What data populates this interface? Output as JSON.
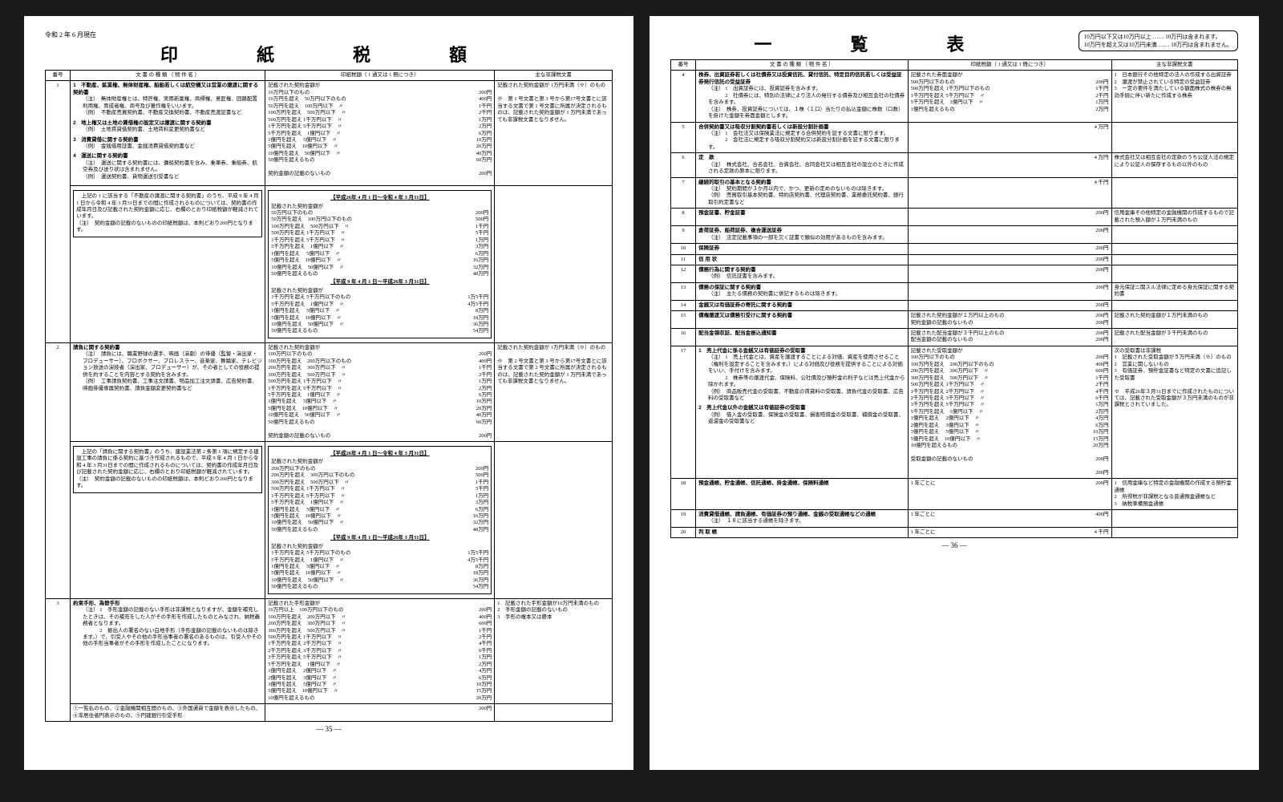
{
  "meta": {
    "date": "令和 2 年 6 月現在",
    "page_left": "— 35 —",
    "page_right": "— 36 —",
    "title_left": "印　紙　税　額",
    "title_right": "一　覧　表",
    "top_note": [
      "10万円以下又は10万円以上 …… 10万円は含まれます。",
      "10万円を超え又は10万円未満 …… 10万円は含まれません。"
    ]
  },
  "headers": {
    "num": "番号",
    "doc": "文 書 の 種 類 （ 物 件 名 ）",
    "tax": "印紙税額（ 1 通又は 1 冊につき）",
    "exempt": "主な非課税文書"
  },
  "rowL1": {
    "num": "1",
    "docs": [
      {
        "h": "1　不動産、鉱業権、無体財産権、船舶若しくは航空機又は営業の譲渡に関する契約書",
        "notes": [
          "（注）　無体財産権とは、特許権、実用新案権、商標権、意匠権、回路配置利用権、育成者権、商号及び著作権をいいます。",
          "（例）　不動産売買契約書、不動産交換契約書、不動産売渡証書など"
        ]
      },
      {
        "h": "2　地上権又は土地の賃借権の設定又は譲渡に関する契約書",
        "notes": [
          "（例）　土地賃貸借契約書、土地賃料変更契約書など"
        ]
      },
      {
        "h": "3　消費貸借に関する契約書",
        "notes": [
          "（例）　金銭借用証書、金銭消費貸借契約書など"
        ]
      },
      {
        "h": "4　運送に関する契約書",
        "notes": [
          "（注）　運送に関する契約書には、傭船契約書を含み、乗車券、乗船券、航空券及び送り状は含まれません。",
          "（例）　運送契約書、貨物運送引受書など"
        ]
      }
    ],
    "tax_head": "記載された契約金額が",
    "tax": [
      [
        "10万円以下のもの",
        "200円"
      ],
      [
        "10万円を超え　50万円以下のもの",
        "400円"
      ],
      [
        "50万円を超え　100万円以下　〃",
        "1千円"
      ],
      [
        "100万円を超え　500万円以下　〃",
        "2千円"
      ],
      [
        "500万円を超え 1千万円以下　〃",
        "1万円"
      ],
      [
        "1千万円を超え 5千万円以下　〃",
        "2万円"
      ],
      [
        "5千万円を超え　1億円以下　〃",
        "6万円"
      ],
      [
        "1億円を超え　 5億円以下　〃",
        "10万円"
      ],
      [
        "5億円を超え　10億円以下　〃",
        "20万円"
      ],
      [
        "10億円を超え　50億円以下　〃",
        "40万円"
      ],
      [
        "50億円を超えるもの",
        "60万円"
      ],
      [
        "",
        ""
      ],
      [
        "契約金額の記載のないもの",
        "200円"
      ]
    ],
    "exempt": [
      "記載された契約金額が 1万円未満（※）のもの",
      "",
      "※　第 1 号文書と第 3 号から第17号文書とに該当する文書で第 1 号文書に所属が決定されるものは、記載された契約金額が 1 万円未満であっても非課税文書となりません。"
    ]
  },
  "rowL1b": {
    "intro": "　上記の 1 に該当する「不動産の譲渡に関する契約書」のうち、平成 9 年 4 月 1 日から令和 4 年 3 月31日までの間に作成されるものについては、契約書の作成年月日及び記載された契約金額に応じ、右欄のとおり印紙税額が軽減されています。",
    "note": "（注）　契約金額の記載のないものの印紙税額は、本則どおり200円となります。",
    "periodA": "【平成26年 4 月 1 日〜令和 4 年 3 月31日】",
    "taxA": [
      [
        "50万円以下のもの",
        "200円"
      ],
      [
        "50万円を超え　100万円以下のもの",
        "500円"
      ],
      [
        "100万円を超え　500万円以下　〃",
        "1千円"
      ],
      [
        "500万円を超え 1千万円以下　〃",
        "5千円"
      ],
      [
        "1千万円を超え 5千万円以下　〃",
        "1万円"
      ],
      [
        "5千万円を超え　1億円以下　〃",
        "3万円"
      ],
      [
        "1億円を超え　 5億円以下　〃",
        "6万円"
      ],
      [
        "5億円を超え　10億円以下　〃",
        "16万円"
      ],
      [
        "10億円を超え　50億円以下　〃",
        "32万円"
      ],
      [
        "50億円を超えるもの",
        "48万円"
      ]
    ],
    "periodB": "【平成 9 年 4 月 1 日〜平成26年 3 月31日】",
    "taxB": [
      [
        "1千万円を超え 5千万円以下のもの",
        "1万5千円"
      ],
      [
        "5千万円を超え　1億円以下　〃",
        "4万5千円"
      ],
      [
        "1億円を超え　 5億円以下　〃",
        "8万円"
      ],
      [
        "5億円を超え　10億円以下　〃",
        "18万円"
      ],
      [
        "10億円を超え　50億円以下　〃",
        "36万円"
      ],
      [
        "50億円を超えるもの",
        "54万円"
      ]
    ]
  },
  "rowL2": {
    "num": "2",
    "doc": {
      "h": "請負に関する契約書",
      "notes": [
        "（注）　請負には、職業野球の選手、映画（演劇）の俳優（監督・演出家・プロデューサー）、プロボクサー、プロレスラー、音楽家、舞踊家、テレビジョン放送の演技者（演出家、プロデューサー）が、その者としての役務の提供を約することを内容とする契約を含みます。",
        "（例）　工事請負契約書、工事注文請書、物品加工注文請書、広告契約書、映画俳優専属契約書、請負金額変更契約書など"
      ]
    },
    "tax_head": "記載された契約金額が",
    "tax": [
      [
        "100万円以下のもの",
        "200円"
      ],
      [
        "100万円を超え　200万円以下のもの",
        "400円"
      ],
      [
        "200万円を超え　300万円以下　〃",
        "1千円"
      ],
      [
        "300万円を超え　500万円以下　〃",
        "2千円"
      ],
      [
        "500万円を超え 1千万円以下　〃",
        "1万円"
      ],
      [
        "1千万円を超え 5千万円以下　〃",
        "2万円"
      ],
      [
        "5千万円を超え　1億円以下　〃",
        "6万円"
      ],
      [
        "1億円を超え　 5億円以下　〃",
        "10万円"
      ],
      [
        "5億円を超え　10億円以下　〃",
        "20万円"
      ],
      [
        "10億円を超え　50億円以下　〃",
        "40万円"
      ],
      [
        "50億円を超えるもの",
        "60万円"
      ],
      [
        "",
        ""
      ],
      [
        "契約金額の記載のないもの",
        "200円"
      ]
    ],
    "exempt": [
      "記載された契約金額が 1万円未満（※）のもの",
      "",
      "※　第 2 号文書と第 3 号から第17号文書とに該当する文書で第 2 号文書に所属が決定されるものは、記載された契約金額が 1 万円未満であっても非課税文書となりません。"
    ]
  },
  "rowL2b": {
    "intro": "　上記の「請負に関する契約書」のうち、建設業法第 2 条第 1 項に規定する建設工事の請負に係る契約に基づき作成されるもので、平成 9 年 4 月 1 日から令和 4 年 3 月31日までの間に作成されるものについては、契約書の作成年月日及び記載された契約金額に応じ、右欄のとおり印紙税額が軽減されています。",
    "note": "（注）　契約金額の記載のないものの印紙税額は、本則どおり200円となります。",
    "periodA": "【平成26年 4 月 1 日〜令和 4 年 3 月31日】",
    "taxA": [
      [
        "200万円以下のもの",
        "200円"
      ],
      [
        "200万円を超え　300万円以下のもの",
        "500円"
      ],
      [
        "300万円を超え　500万円以下　〃",
        "1千円"
      ],
      [
        "500万円を超え 1千万円以下　〃",
        "5千円"
      ],
      [
        "1千万円を超え 5千万円以下　〃",
        "1万円"
      ],
      [
        "5千万円を超え　1億円以下　〃",
        "3万円"
      ],
      [
        "1億円を超え　 5億円以下　〃",
        "6万円"
      ],
      [
        "5億円を超え　10億円以下　〃",
        "16万円"
      ],
      [
        "10億円を超え　50億円以下　〃",
        "32万円"
      ],
      [
        "50億円を超えるもの",
        "48万円"
      ]
    ],
    "periodB": "【平成 9 年 4 月 1 日〜平成26年 3 月31日】",
    "taxB": [
      [
        "1千万円を超え 5千万円以下のもの",
        "1万5千円"
      ],
      [
        "5千万円を超え　1億円以下　〃",
        "4万5千円"
      ],
      [
        "1億円を超え　 5億円以下　〃",
        "8万円"
      ],
      [
        "5億円を超え　10億円以下　〃",
        "18万円"
      ],
      [
        "10億円を超え　50億円以下　〃",
        "36万円"
      ],
      [
        "50億円を超えるもの",
        "54万円"
      ]
    ]
  },
  "rowL3": {
    "num": "3",
    "doc": {
      "h": "約束手形、為替手形",
      "notes": [
        "（注） 1　手形金額の記載のない手形は非課税となりますが、金額を補充したときは、その補充をした人がその手形を作成したものとみなされ、納税義務者となります。",
        "　　　 2　振出人の署名のない白地手形（手形金額の記載のないものは除きます。）で、引受人やその他の手形当事者の署名のあるものは、引受人やその他の手形当事者がその手形を作成したことになります。"
      ]
    },
    "tax_head": "記載された手形金額が",
    "tax": [
      [
        "10万円以上　100万円以下のもの",
        "200円"
      ],
      [
        "100万円を超え　200万円以下　〃",
        "400円"
      ],
      [
        "200万円を超え　300万円以下　〃",
        "600円"
      ],
      [
        "300万円を超え　500万円以下　〃",
        "1千円"
      ],
      [
        "500万円を超え 1千万円以下　〃",
        "2千円"
      ],
      [
        "1千万円を超え 2千万円以下　〃",
        "4千円"
      ],
      [
        "2千万円を超え 3千万円以下　〃",
        "6千円"
      ],
      [
        "3千万円を超え 5千万円以下　〃",
        "1万円"
      ],
      [
        "5千万円を超え　1億円以下　〃",
        "2万円"
      ],
      [
        "1億円を超え　 2億円以下　〃",
        "4万円"
      ],
      [
        "2億円を超え　 3億円以下　〃",
        "6万円"
      ],
      [
        "3億円を超え　 5億円以下　〃",
        "10万円"
      ],
      [
        "5億円を超え　10億円以下　〃",
        "15万円"
      ],
      [
        "10億円を超えるもの",
        "20万円"
      ]
    ],
    "exempt": [
      "1　記載された手形金額が10万円未満のもの",
      "2　手形金額の記載のないもの",
      "3　手形の複本又は謄本"
    ],
    "foot": "①一覧払のもの、②金融機関相互間のもの、③外国通貨で金額を表示したもの、④非居住者円表示のもの、⑤円建銀行引受手形",
    "foot_amt": "200円"
  },
  "rowsR": [
    {
      "n": "4",
      "doc": "株券、出資証券若しくは社債券又は投資信託、貸付信託、特定目的信託若しくは受益証券発行信託の受益証券",
      "notes": [
        "（注） 1　出資証券には、投資証券を含みます。",
        "　　　 2　社債券には、特別の法律により法人の発行する債券及び相互会社の社債券を含みます。",
        "",
        "（注）　株券、投資証券については、１株（１口）当たりの払込金額に株数（口数）を掛けた金額を券面金額とします。"
      ],
      "tax_head": "記載された券面金額が",
      "tax": [
        [
          "500万円以下のもの",
          "200円"
        ],
        [
          "500万円を超え 1千万円以下のもの",
          "1千円"
        ],
        [
          "1千万円を超え 5千万円以下　〃",
          "2千円"
        ],
        [
          "5千万円を超え　1億円以下　〃",
          "1万円"
        ],
        [
          "1億円を超えるもの",
          "2万円"
        ]
      ],
      "exempt": [
        "1　日本銀行その他特定の法人の作成する出資証券",
        "2　譲渡が禁止されている特定の受益証券",
        "3　一定の要件を満たしている額面株式の株券の無効手続に伴い新たに作成する株券"
      ]
    },
    {
      "n": "5",
      "doc": "合併契約書又は吸収分割契約書若しくは新設分割計画書",
      "notes": [
        "（注） 1　会社法又は保険業法に規定する合併契約を証する文書に限ります。",
        "　　　 2　会社法に規定する吸収分割契約又は新設分割計画を証する文書に限ります。"
      ],
      "single": "4 万円"
    },
    {
      "n": "6",
      "doc": "定　款",
      "notes": [
        "（注）　株式会社、合名会社、合資会社、合同会社又は相互会社の設立のときに作成される定款の原本に限ります。"
      ],
      "single": "4 万円",
      "exempt": [
        "株式会社又は相互会社の定款のうち公証人法の規定により公証人の保存するもの以外のもの"
      ]
    },
    {
      "n": "7",
      "doc": "継続的取引の基本となる契約書",
      "notes": [
        "（注）　契約期間が３か月以内で、かつ、更新の定めのないものは除きます。",
        "（例）　売買取引基本契約書、特約店契約書、代理店契約書、業務委託契約書、銀行取引約定書など"
      ],
      "single": "4 千円"
    },
    {
      "n": "8",
      "doc": "預金証書、貯金証書",
      "single": "200円",
      "exempt": [
        "信用金庫その他特定の金融機関の作成するもので記載された預入額が１万円未満のもの"
      ]
    },
    {
      "n": "9",
      "doc": "倉荷証券、船荷証券、複合運送証券",
      "notes": [
        "（注）　法定記載事項の一部を欠く証書で類似の効用があるものを含みます。"
      ],
      "single": "200円"
    },
    {
      "n": "10",
      "doc": "保険証券",
      "single": "200円"
    },
    {
      "n": "11",
      "doc": "信 用 状",
      "single": "200円"
    },
    {
      "n": "12",
      "doc": "債務行為に関する契約書",
      "notes": [
        "（例）　信託証書を含みます。"
      ],
      "single": "200円"
    },
    {
      "n": "13",
      "doc": "債務の保証に関する契約書",
      "notes": [
        "（注）　主たる債務の契約書に併記するものは除きます。"
      ],
      "single": "200円",
      "exempt": [
        "身元保証ニ関スル法律に定める身元保証に関する契約書"
      ]
    },
    {
      "n": "14",
      "doc": "金銭又は有価証券の寄託に関する契約書",
      "single": "200円"
    },
    {
      "n": "15",
      "doc": "債権譲渡又は債務引受けに関する契約書",
      "tax": [
        [
          "記載された契約金額が１万円以上のもの",
          "200円"
        ],
        [
          "契約金額の記載のないもの",
          "200円"
        ]
      ],
      "exempt": [
        "記載された契約金額が１万円未満のもの"
      ]
    },
    {
      "n": "16",
      "doc": "配当金領収証、配当金振込通知書",
      "tax": [
        [
          "記載された配当金額が３千円以上のもの",
          "200円"
        ],
        [
          "配当金額の記載のないもの",
          "200円"
        ]
      ],
      "exempt": [
        "記載された配当金額が３千円未満のもの"
      ]
    },
    {
      "n": "17",
      "doc_items": [
        {
          "h": "1　売上代金に係る金銭又は有価証券の受取書",
          "notes": [
            "（注） 1　売上代金とは、資産を譲渡することによる対価、資産を使用させること（権利を設定することを含みます。）による対価及び役務を提供することによる対価をいい、手付けを含みます。",
            "　　　 2　株券等の譲渡代金、保険料、公社債及び預貯金の利子などは売上代金から除かれます。",
            "（例）　商品販売代金の受取書、不動産の賃貸料の受取書、請負代金の受取書、広告料の受取書など"
          ]
        },
        {
          "h": "2　売上代金以外の金銭又は有価証券の受取書",
          "notes": [
            "（例）　借入金の受取書、保険金の受取書、損害賠償金の受取書、補償金の受取書、返還金の受取書など"
          ]
        }
      ],
      "tax_head": "記載された受取金額が",
      "tax": [
        [
          "100万円以下のもの",
          "200円"
        ],
        [
          "100万円を超え　200万円以下のもの",
          "400円"
        ],
        [
          "200万円を超え　300万円以下　〃",
          "600円"
        ],
        [
          "300万円を超え　500万円以下　〃",
          "1千円"
        ],
        [
          "500万円を超え 1千万円以下　〃",
          "2千円"
        ],
        [
          "1千万円を超え 2千万円以下　〃",
          "4千円"
        ],
        [
          "2千万円を超え 3千万円以下　〃",
          "6千円"
        ],
        [
          "3千万円を超え 5千万円以下　〃",
          "1万円"
        ],
        [
          "5千万円を超え　1億円以下　〃",
          "2万円"
        ],
        [
          "1億円を超え　 2億円以下　〃",
          "4万円"
        ],
        [
          "2億円を超え　 3億円以下　〃",
          "6万円"
        ],
        [
          "3億円を超え　 5億円以下　〃",
          "10万円"
        ],
        [
          "5億円を超え　10億円以下　〃",
          "15万円"
        ],
        [
          "10億円を超えるもの",
          "20万円"
        ],
        [
          "",
          ""
        ],
        [
          "受取金額の記載のないもの",
          "200円"
        ],
        [
          "",
          ""
        ],
        [
          "",
          "200円"
        ]
      ],
      "exempt": [
        "次の受取書は非課税",
        "1　記載された受取金額が５万円未満（※）のもの",
        "2　営業に関しないもの",
        "3　有価証券、預貯金証書など特定の文書に追記した受取書",
        "",
        "※　平成26年３月31日までに作成されたものについては、記載された受取金額が３万円未満のものが非課税とされていました。"
      ]
    },
    {
      "n": "18",
      "doc": "預金通帳、貯金通帳、信託通帳、掛金通帳、保険料通帳",
      "single_label": "1 年ごとに",
      "single": "200円",
      "exempt": [
        "1　信用金庫など特定の金融機関の作成する預貯金通帳",
        "2　所得税が非課税となる普通預金通帳など",
        "3　納税準備預金通帳"
      ]
    },
    {
      "n": "19",
      "doc": "消費貸借通帳、請負通帳、有価証券の預り通帳、金銭の受取通帳などの通帳",
      "notes": [
        "（注）　１８に該当する通帳を除きます。"
      ],
      "single_label": "1 年ごとに",
      "single": "400円"
    },
    {
      "n": "20",
      "doc": "判 取 帳",
      "single_label": "1 年ごとに",
      "single": "4 千円"
    }
  ]
}
